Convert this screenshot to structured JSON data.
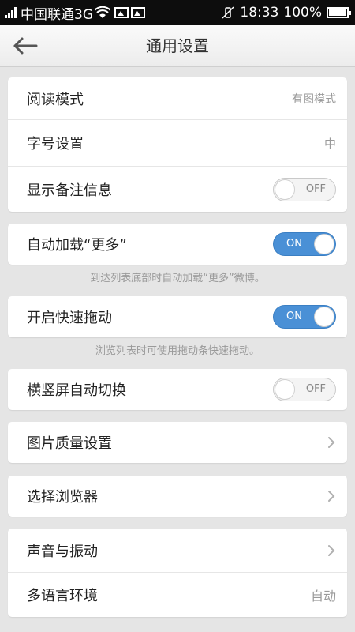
{
  "status_bar": {
    "carrier": "中国联通3G",
    "time": "18:33",
    "battery": "100%"
  },
  "header": {
    "title": "通用设置",
    "back_icon": "arrow-left-icon"
  },
  "settings": {
    "reading_mode": {
      "label": "阅读模式",
      "value": "有图模式"
    },
    "font_size": {
      "label": "字号设置",
      "value": "中"
    },
    "show_remark": {
      "label": "显示备注信息",
      "toggle": "OFF"
    },
    "auto_load": {
      "label": "自动加载“更多”",
      "toggle": "ON",
      "hint": "到达列表底部时自动加载“更多”微博。"
    },
    "fast_scroll": {
      "label": "开启快速拖动",
      "toggle": "ON",
      "hint": "浏览列表时可使用拖动条快速拖动。"
    },
    "auto_rotate": {
      "label": "横竖屏自动切换",
      "toggle": "OFF"
    },
    "image_quality": {
      "label": "图片质量设置"
    },
    "browser": {
      "label": "选择浏览器"
    },
    "sound_vibration": {
      "label": "声音与振动"
    },
    "language": {
      "label": "多语言环境",
      "value": "自动"
    }
  },
  "colors": {
    "toggle_on": "#4a90d6",
    "background": "#e5e5e5"
  }
}
